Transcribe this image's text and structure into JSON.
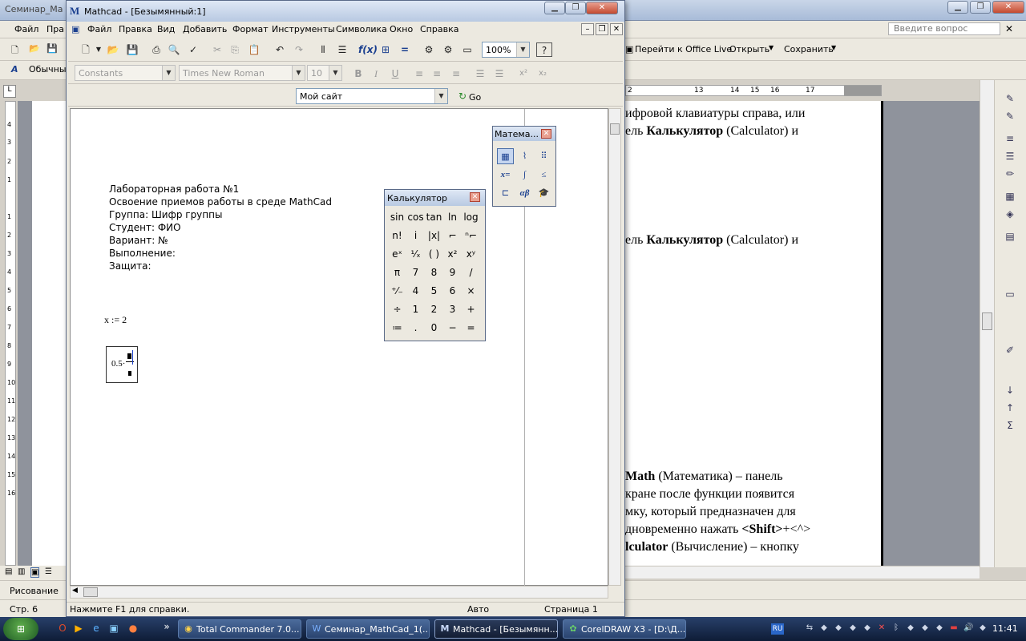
{
  "word": {
    "title": "Семинар_Ma",
    "menu": [
      "Файл",
      "Пра"
    ],
    "ask_placeholder": "Введите вопрос",
    "toolbar": {
      "office_live": "Перейти к Office Live",
      "open": "Открыть",
      "save": "Сохранить",
      "style": "Обычны"
    },
    "ruler_top": [
      "2",
      "13",
      "14",
      "15",
      "16",
      "17"
    ],
    "ruler_left": [
      "4",
      "3",
      "2",
      "1",
      "1",
      "2",
      "3",
      "4",
      "5",
      "6",
      "7",
      "8",
      "9",
      "10",
      "11",
      "12",
      "13",
      "14",
      "15",
      "16"
    ],
    "doc_lines": [
      {
        "html": "ифровой клавиатуры справа, или"
      },
      {
        "html": "ель <b>Калькулятор</b> (Calculator) и"
      },
      {
        "html": "ель <b>Калькулятор</b> (Calculator) и"
      },
      {
        "html": "<b>Math</b> (Математика) – панель"
      },
      {
        "html": "кране после функции появится"
      },
      {
        "html": "мку, который предназначен для"
      },
      {
        "html": "дновременно нажать <b>&lt;Shift&gt;</b>+&lt;^&gt;"
      },
      {
        "html": "<b>lculator</b> (Вычисление) – кнопку"
      }
    ],
    "drawing_label": "Рисование",
    "status_page": "Стр. 6"
  },
  "mathcad": {
    "title": "Mathcad - [Безымянный:1]",
    "menu": [
      "Файл",
      "Правка",
      "Вид",
      "Добавить",
      "Формат",
      "Инструменты",
      "Символика",
      "Окно",
      "Справка"
    ],
    "zoom": "100%",
    "style_combo": "Constants",
    "font_combo": "Times New Roman",
    "size_combo": "10",
    "resource_combo": "Мой сайт",
    "go_label": "Go",
    "worksheet_lines": [
      "Лабораторная работа №1",
      "Освоение приемов работы в среде MathCad",
      "Группа: Шифр группы",
      "Студент: ФИО",
      "Вариант: №",
      "Выполнение:",
      "Защита:"
    ],
    "assignment": "x := 2",
    "expression_value": "0.5·",
    "status": {
      "help": "Нажмите F1 для справки.",
      "mode": "Авто",
      "page": "Страница 1"
    }
  },
  "math_palette": {
    "title": "Матема...",
    "buttons": [
      "calculator-icon",
      "graph-icon",
      "matrix-icon",
      "evaluation-icon",
      "calculus-icon",
      "boolean-icon",
      "programming-icon",
      "greek-icon",
      "symbolic-icon"
    ]
  },
  "calculator": {
    "title": "Калькулятор",
    "keys": [
      [
        "sin",
        "cos",
        "tan",
        "ln",
        "log"
      ],
      [
        "n!",
        "i",
        "|x|",
        "⌐",
        "ⁿ⌐"
      ],
      [
        "eˣ",
        "¹⁄ₓ",
        "( )",
        "x²",
        "xʸ"
      ],
      [
        "π",
        "7",
        "8",
        "9",
        "/"
      ],
      [
        "⁺⁄₋",
        "4",
        "5",
        "6",
        "×"
      ],
      [
        "÷",
        "1",
        "2",
        "3",
        "+"
      ],
      [
        "≔",
        ".",
        "0",
        "−",
        "="
      ]
    ]
  },
  "taskbar": {
    "tasks": [
      {
        "label": "Total Commander 7.0...",
        "active": false
      },
      {
        "label": "Семинар_MathCad_1(...",
        "active": false
      },
      {
        "label": "Mathcad - [Безымянн...",
        "active": true
      },
      {
        "label": "CorelDRAW X3 - [D:\\Д...",
        "active": false
      }
    ],
    "lang": "RU",
    "clock": "11:41"
  }
}
